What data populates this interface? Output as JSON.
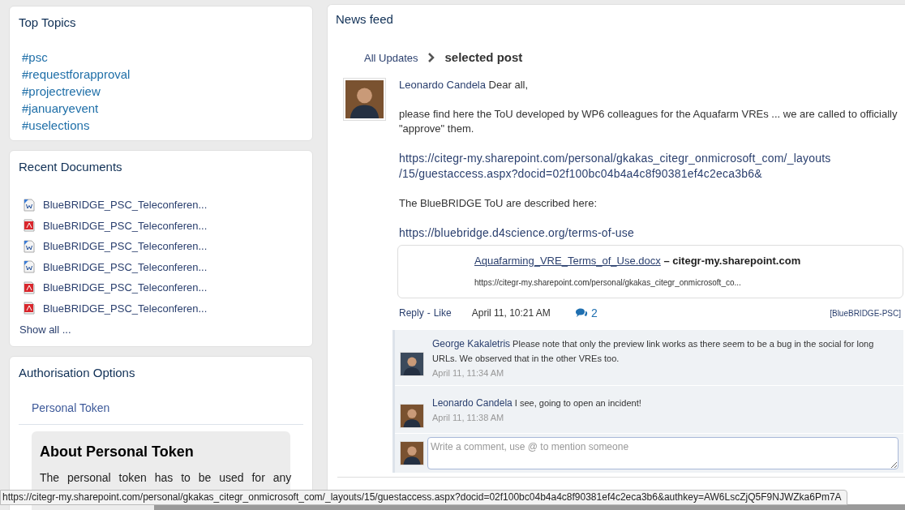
{
  "top_topics": {
    "title": "Top Topics",
    "items": [
      "#psc",
      "#requestforapproval",
      "#projectreview",
      "#januaryevent",
      "#uselections"
    ]
  },
  "recent_documents": {
    "title": "Recent Documents",
    "items": [
      {
        "kind": "word",
        "name": "BlueBRIDGE_PSC_Teleconferen..."
      },
      {
        "kind": "pdf",
        "name": "BlueBRIDGE_PSC_Teleconferen..."
      },
      {
        "kind": "word",
        "name": "BlueBRIDGE_PSC_Teleconferen..."
      },
      {
        "kind": "word",
        "name": "BlueBRIDGE_PSC_Teleconferen..."
      },
      {
        "kind": "pdf",
        "name": "BlueBRIDGE_PSC_Teleconferen..."
      },
      {
        "kind": "pdf",
        "name": "BlueBRIDGE_PSC_Teleconferen..."
      }
    ],
    "show_all": "Show all ..."
  },
  "authorisation": {
    "title": "Authorisation Options",
    "tab": "Personal Token",
    "box_title": "About Personal Token",
    "box_text": "The personal token has to be used for any"
  },
  "news_feed": {
    "title": "News feed",
    "breadcrumb": [
      "All Updates",
      "selected post"
    ],
    "post": {
      "author": "Leonardo Candela",
      "greeting": "Dear all,",
      "paragraphs": [
        {
          "kind": "text",
          "text": "please find here the ToU developed by WP6 colleagues for the Aquafarm VREs ... we are called to officially \"approve\" them."
        },
        {
          "kind": "link",
          "text": "https://citegr-my.sharepoint.com/personal/gkakas_citegr_onmicrosoft_com/_layouts /15/guestaccess.aspx?docid=02f100bc04b4a4c8f90381ef4c2eca3b6&"
        },
        {
          "kind": "text",
          "text": "The BlueBRIDGE ToU are described here:"
        },
        {
          "kind": "link",
          "text": "https://bluebridge.d4science.org/terms-of-use"
        }
      ],
      "preview": {
        "title": "Aquafarming_VRE_Terms_of_Use.docx",
        "separator": "–",
        "site": "citegr-my.sharepoint.com",
        "url": "https://citegr-my.sharepoint.com/personal/gkakas_citegr_onmicrosoft_co..."
      },
      "actions": [
        "Reply",
        "-",
        "Like"
      ],
      "time": "April 11, 10:21 AM",
      "comment_count": "2",
      "group": "[BlueBRIDGE-PSC]",
      "comments": [
        {
          "author": "George Kakaletris",
          "text": "Please note that only the preview link works as there seem to be a bug in the social for long URLs. We observed that in the other VREs too.",
          "time": "April 11, 11:34 AM"
        },
        {
          "author": "Leonardo Candela",
          "text": "I see, going to open an incident!",
          "time": "April 11, 11:38 AM"
        }
      ],
      "comment_placeholder": "Write a comment, use @ to mention someone"
    }
  },
  "status_bar": "https://citegr-my.sharepoint.com/personal/gkakas_citegr_onmicrosoft_com/_layouts/15/guestaccess.aspx?docid=02f100bc04b4a4c8f90381ef4c2eca3b6&authkey=AW6LscZjQ5F9NJWZka6Pm7A"
}
